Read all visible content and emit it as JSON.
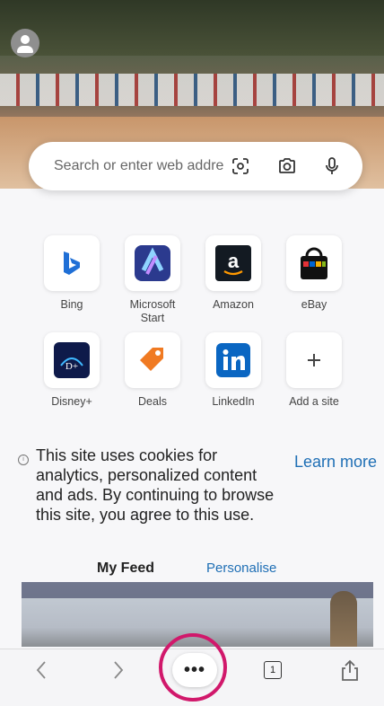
{
  "search": {
    "placeholder": "Search or enter web address"
  },
  "top_sites": [
    {
      "label": "Bing",
      "icon": "bing-icon"
    },
    {
      "label": "Microsoft\nStart",
      "icon": "microsoft-start-icon"
    },
    {
      "label": "Amazon",
      "icon": "amazon-icon"
    },
    {
      "label": "eBay",
      "icon": "ebay-icon"
    },
    {
      "label": "Disney+",
      "icon": "disney-plus-icon"
    },
    {
      "label": "Deals",
      "icon": "deals-icon"
    },
    {
      "label": "LinkedIn",
      "icon": "linkedin-icon"
    },
    {
      "label": "Add a site",
      "icon": "plus-icon"
    }
  ],
  "cookie_notice": {
    "text": "This site uses cookies for analytics, personalized content and ads. By continuing to browse this site, you agree to this use.",
    "learn_more": "Learn more"
  },
  "feed": {
    "title": "My Feed",
    "personalize": "Personalise"
  },
  "toolbar": {
    "more_label": "•••",
    "tabs_count": "1"
  },
  "colors": {
    "accent_ring": "#d1186b",
    "link": "#1f6fb5",
    "bing": "#1f6fd6",
    "linkedin": "#0a66c2"
  }
}
